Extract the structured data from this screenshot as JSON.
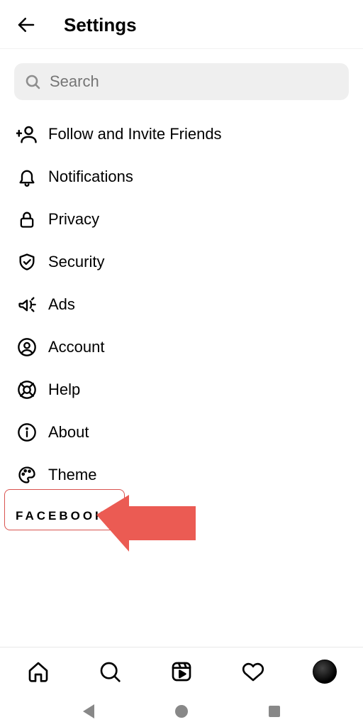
{
  "header": {
    "title": "Settings"
  },
  "search": {
    "placeholder": "Search"
  },
  "menu": {
    "follow": {
      "label": "Follow and Invite Friends"
    },
    "notifications": {
      "label": "Notifications"
    },
    "privacy": {
      "label": "Privacy"
    },
    "security": {
      "label": "Security"
    },
    "ads": {
      "label": "Ads"
    },
    "account": {
      "label": "Account"
    },
    "help": {
      "label": "Help"
    },
    "about": {
      "label": "About"
    },
    "theme": {
      "label": "Theme"
    }
  },
  "footer": {
    "brand": "FACEBOOK"
  },
  "annotation": {
    "highlight_target": "help",
    "arrow_color": "#eb5b53"
  }
}
